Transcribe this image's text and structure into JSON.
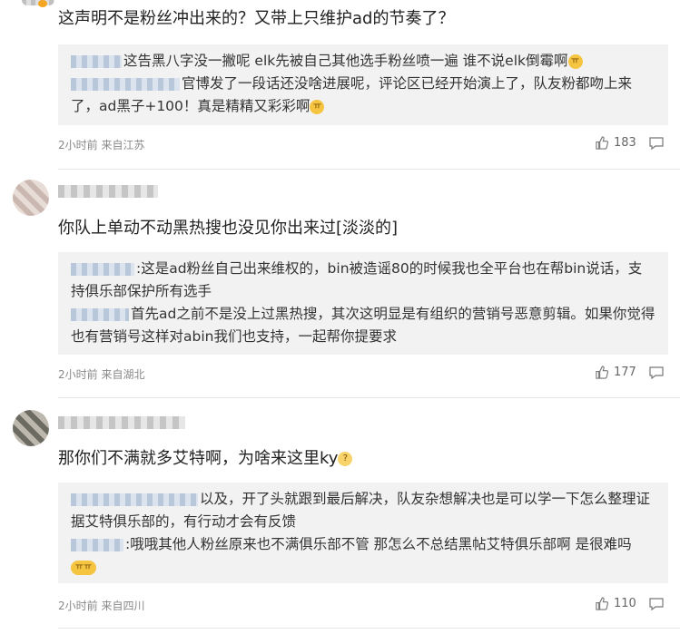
{
  "comments": [
    {
      "text": "这声明不是粉丝冲出来的？又带上只维护ad的节奏了？",
      "replies": [
        {
          "text": "这告黑八字没一撇呢 elk先被自己其他选手粉丝喷一遍 谁不说elk倒霉啊",
          "emoji": "ㅠ"
        },
        {
          "text": "官博发了一段话还没啥进展呢，评论区已经开始演上了，队友粉都吻上来了，ad黑子+100！真是精精又彩彩啊",
          "emoji": "ㅠ"
        }
      ],
      "meta": "2小时前 来自江苏",
      "likes": "183"
    },
    {
      "text": "你队上单动不动黑热搜也没见你出来过[淡淡的]",
      "replies": [
        {
          "text": ":这是ad粉丝自己出来维权的，bin被造谣80的时候我也全平台也在帮bin说话，支持俱乐部保护所有选手"
        },
        {
          "text": "首先ad之前不是没上过黑热搜，其次这明显是有组织的营销号恶意剪辑。如果你觉得也有营销号这样对abin我们也支持，一起帮你提要求"
        }
      ],
      "meta": "2小时前 来自湖北",
      "likes": "177"
    },
    {
      "text": "那你们不满就多艾特啊，为啥来这里ky",
      "replies": [
        {
          "text": "以及，开了头就跟到最后解决，队友杂想解决也是可以学一下怎么整理证据艾特俱乐部的，有行动才会有反馈"
        },
        {
          "text": ":哦哦其他人粉丝原来也不满俱乐部不管 那怎么不总结黑帖艾特俱乐部啊 是很难吗",
          "emoji": "ㅠㅠ"
        }
      ],
      "meta": "2小时前 来自四川",
      "likes": "110"
    }
  ],
  "icons": {
    "like": "thumbs-up-icon",
    "reply": "comment-bubble-icon"
  }
}
